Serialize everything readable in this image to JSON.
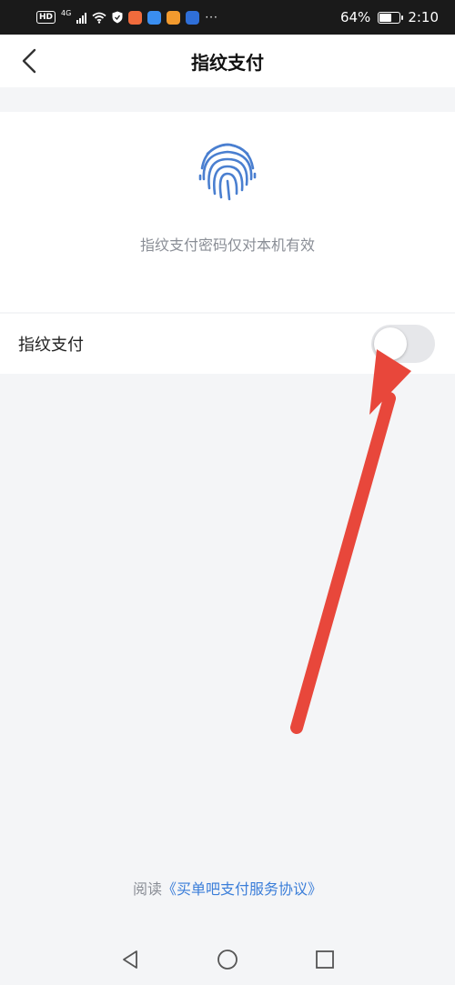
{
  "status_bar": {
    "network": "4G",
    "battery_percent_text": "64%",
    "battery_level": 0.64,
    "time": "2:10",
    "icons": [
      "hd-icon",
      "signal-icon",
      "wifi-icon",
      "shield-icon",
      "app-icon",
      "cloud-icon",
      "play-icon",
      "lightbulb-icon",
      "more-icon"
    ]
  },
  "nav": {
    "title": "指纹支付",
    "back_icon": "chevron-left-icon"
  },
  "hero": {
    "icon": "fingerprint-icon",
    "description": "指纹支付密码仅对本机有效"
  },
  "setting": {
    "label": "指纹支付",
    "toggle_on": false
  },
  "agreement": {
    "prefix": "阅读",
    "link": "《买单吧支付服务协议》"
  },
  "colors": {
    "accent": "#3b7ed9",
    "arrow": "#e8473b",
    "background": "#f4f5f7"
  },
  "system_nav": {
    "icons": [
      "back-triangle-icon",
      "home-circle-icon",
      "recents-square-icon"
    ]
  }
}
